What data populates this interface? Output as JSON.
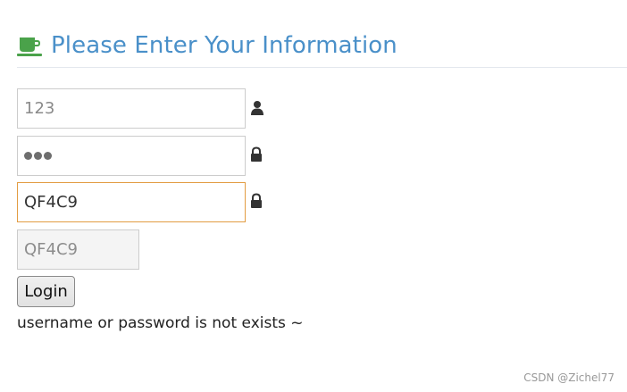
{
  "header": {
    "title": "Please Enter Your Information",
    "icon": "coffee-cup-icon",
    "icon_color": "#4aa24a",
    "title_color": "#4a90c9"
  },
  "form": {
    "username": {
      "value": "123",
      "icon": "user-icon"
    },
    "password": {
      "masked_value": "●●●",
      "icon": "lock-icon"
    },
    "captcha_input": {
      "value": "QF4C9",
      "icon": "lock-icon",
      "focus_border_color": "#e29c42"
    },
    "captcha_image_text": "QF4C9",
    "login_label": "Login",
    "error_message": "username or password is not exists ~"
  },
  "watermark": "CSDN @Zichel77"
}
